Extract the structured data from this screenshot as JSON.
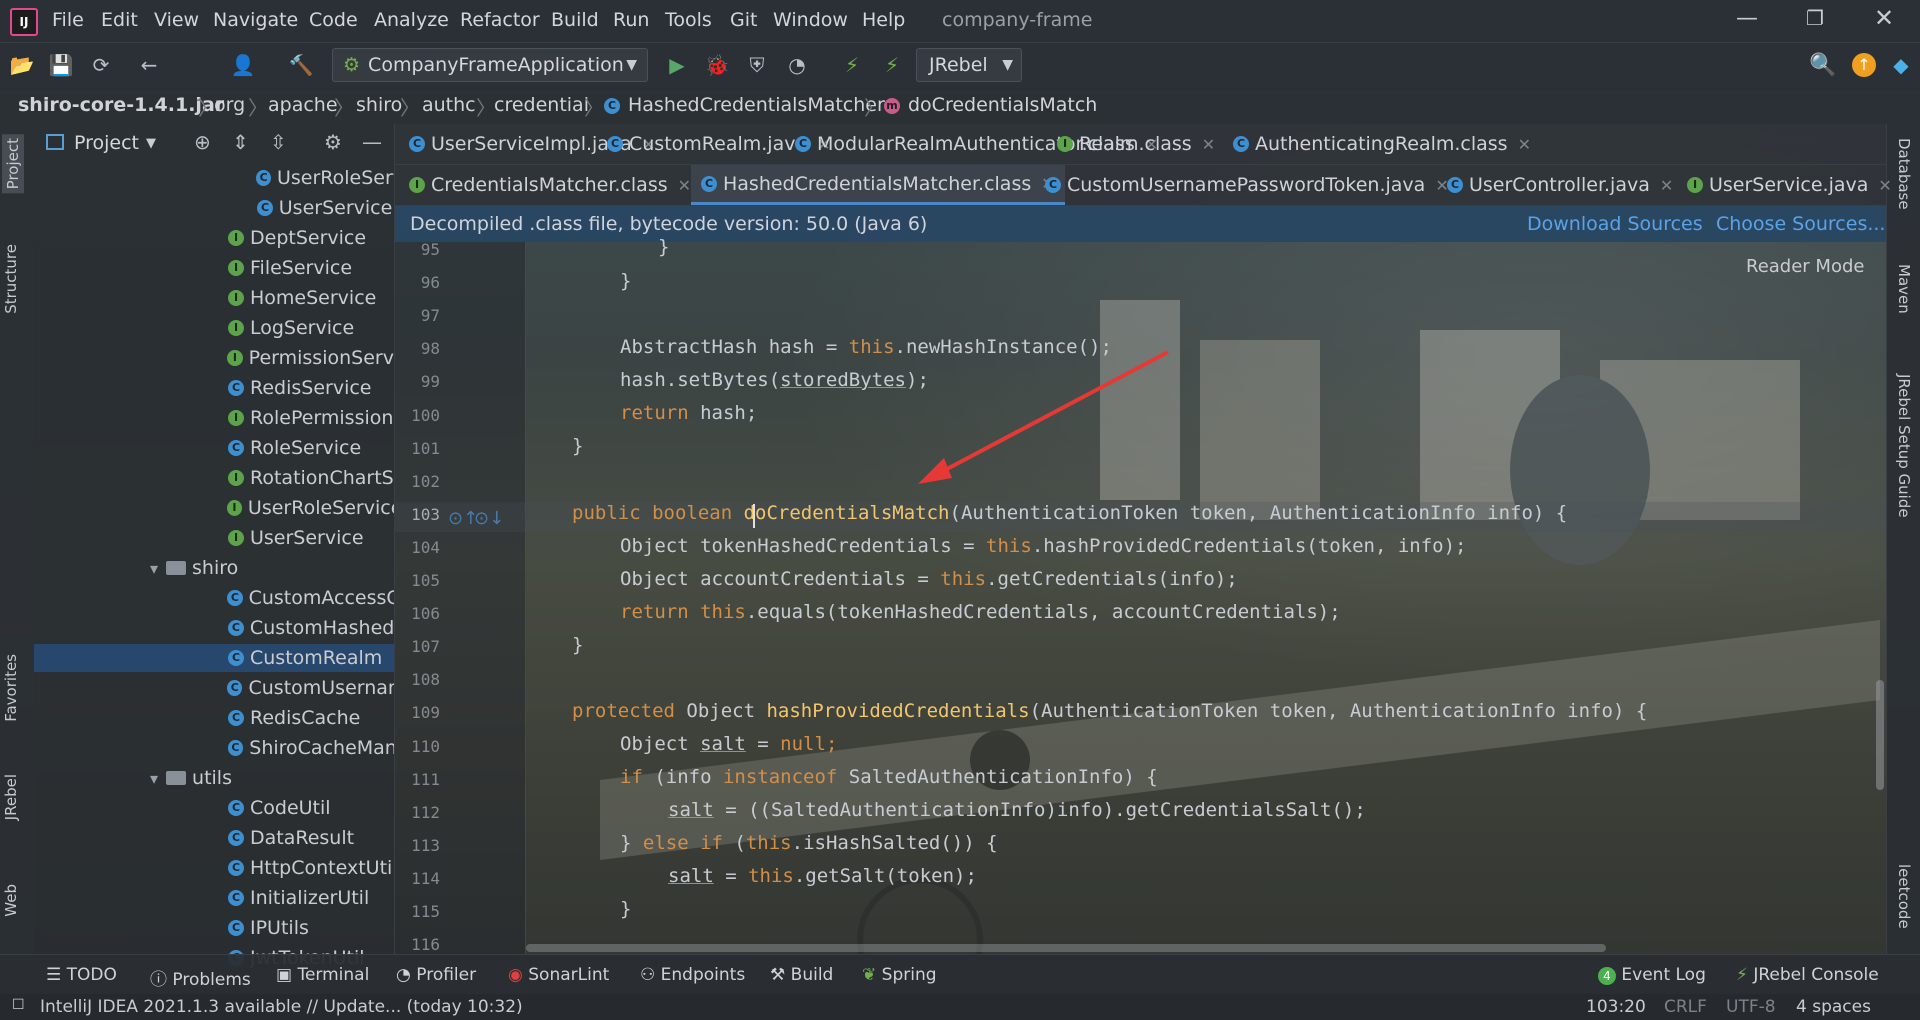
{
  "app": {
    "title": "company-frame",
    "menu": [
      "File",
      "Edit",
      "View",
      "Navigate",
      "Code",
      "Analyze",
      "Refactor",
      "Build",
      "Run",
      "Tools",
      "Git",
      "Window",
      "Help"
    ]
  },
  "toolbar": {
    "run_config": "CompanyFrameApplication",
    "jrebel": "JRebel"
  },
  "breadcrumb": [
    "shiro-core-1.4.1.jar",
    "org",
    "apache",
    "shiro",
    "authc",
    "credential",
    "HashedCredentialsMatcher",
    "doCredentialsMatch"
  ],
  "left_stripe": [
    "Project",
    "Structure",
    "Favorites",
    "JRebel",
    "Web"
  ],
  "right_stripe": [
    "Database",
    "Maven",
    "JRebel Setup Guide",
    "leetcode"
  ],
  "project": {
    "header": "Project",
    "items": [
      {
        "label": "UserRoleServ",
        "kind": "class"
      },
      {
        "label": "UserServiceI",
        "kind": "class"
      },
      {
        "label": "DeptService",
        "kind": "interface"
      },
      {
        "label": "FileService",
        "kind": "interface"
      },
      {
        "label": "HomeService",
        "kind": "interface"
      },
      {
        "label": "LogService",
        "kind": "interface"
      },
      {
        "label": "PermissionServi",
        "kind": "interface"
      },
      {
        "label": "RedisService",
        "kind": "class"
      },
      {
        "label": "RolePermission",
        "kind": "interface"
      },
      {
        "label": "RoleService",
        "kind": "class"
      },
      {
        "label": "RotationChartS",
        "kind": "interface"
      },
      {
        "label": "UserRoleService",
        "kind": "interface"
      },
      {
        "label": "UserService",
        "kind": "interface"
      },
      {
        "label": "shiro",
        "kind": "folder"
      },
      {
        "label": "CustomAccessC",
        "kind": "class"
      },
      {
        "label": "CustomHashed",
        "kind": "class"
      },
      {
        "label": "CustomRealm",
        "kind": "class"
      },
      {
        "label": "CustomUsernan",
        "kind": "class"
      },
      {
        "label": "RedisCache",
        "kind": "class"
      },
      {
        "label": "ShiroCacheMan",
        "kind": "class"
      },
      {
        "label": "utils",
        "kind": "folder"
      },
      {
        "label": "CodeUtil",
        "kind": "class"
      },
      {
        "label": "DataResult",
        "kind": "class"
      },
      {
        "label": "HttpContextUti",
        "kind": "class"
      },
      {
        "label": "InitializerUtil",
        "kind": "class"
      },
      {
        "label": "IPUtils",
        "kind": "class"
      },
      {
        "label": "JwtTokenUtil",
        "kind": "class"
      }
    ]
  },
  "tabs_row1": [
    "UserServiceImpl.java",
    "CustomRealm.java",
    "ModularRealmAuthenticator.class",
    "Realm.class",
    "AuthenticatingRealm.class"
  ],
  "tabs_row2": [
    "CredentialsMatcher.class",
    "HashedCredentialsMatcher.class",
    "CustomUsernamePasswordToken.java",
    "UserController.java",
    "UserService.java"
  ],
  "banner": {
    "text": "Decompiled .class file, bytecode version: 50.0 (Java 6)",
    "download": "Download Sources",
    "choose": "Choose Sources..."
  },
  "reader_mode": "Reader Mode",
  "line_numbers": [
    "95",
    "96",
    "97",
    "98",
    "99",
    "100",
    "101",
    "102",
    "103",
    "104",
    "105",
    "106",
    "107",
    "108",
    "109",
    "110",
    "111",
    "112",
    "113",
    "114",
    "115",
    "116"
  ],
  "code": {
    "l95": "}",
    "l96": "}",
    "l98a": "AbstractHash hash = ",
    "l98b": "this",
    "l98c": ".newHashInstance();",
    "l99a": "hash.setBytes(",
    "l99b": "storedBytes",
    "l99c": ");",
    "l100a": "return",
    "l100b": " hash;",
    "l101": "}",
    "l103a": "public boolean ",
    "l103b": "doCredentialsMatch",
    "l103c": "(AuthenticationToken token, AuthenticationInfo info) {",
    "l104a": "Object tokenHashedCredentials = ",
    "l104b": "this",
    "l104c": ".hashProvidedCredentials(token, info);",
    "l105a": "Object accountCredentials = ",
    "l105b": "this",
    "l105c": ".getCredentials(info);",
    "l106a": "return this",
    "l106b": ".equals(tokenHashedCredentials, accountCredentials);",
    "l107": "}",
    "l109a": "protected ",
    "l109b": "Object ",
    "l109c": "hashProvidedCredentials",
    "l109d": "(AuthenticationToken token, AuthenticationInfo info) {",
    "l110a": "Object ",
    "l110b": "salt",
    "l110c": " = ",
    "l110d": "null",
    "l110e": ";",
    "l111a": "if",
    "l111b": " (info ",
    "l111c": "instanceof",
    "l111d": " SaltedAuthenticationInfo) {",
    "l112a": "salt",
    "l112b": " = ((SaltedAuthenticationInfo)info).getCredentialsSalt();",
    "l113a": "} ",
    "l113b": "else if",
    "l113c": " (",
    "l113d": "this",
    "l113e": ".isHashSalted()) {",
    "l114a": "salt",
    "l114b": " = ",
    "l114c": "this",
    "l114d": ".getSalt(token);",
    "l115": "}"
  },
  "bottom_tools": [
    "TODO",
    "Problems",
    "Terminal",
    "Profiler",
    "SonarLint",
    "Endpoints",
    "Build",
    "Spring"
  ],
  "bottom_right": {
    "event_log_count": "4",
    "event_log": "Event Log",
    "jrebel_console": "JRebel Console"
  },
  "status": {
    "message": "IntelliJ IDEA 2021.1.3 available // Update... (today 10:32)",
    "position": "103:20",
    "line_sep": "CRLF",
    "encoding": "UTF-8",
    "indent": "4 spaces"
  },
  "colors": {
    "keyword": "#d38e48",
    "method": "#f2c66d",
    "link": "#5aa3e8",
    "accent": "#4a88c7"
  }
}
